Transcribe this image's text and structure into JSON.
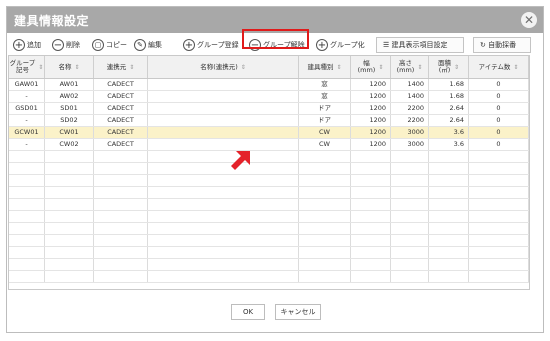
{
  "dialog": {
    "title": "建具情報設定"
  },
  "toolbar": {
    "add": "追加",
    "delete": "削除",
    "copy": "コピー",
    "edit": "編集",
    "group_register": "グループ登録",
    "group_release": "グループ解除",
    "group_more": "グループ化",
    "display_settings": "建具表示項目設定",
    "auto_collect": "自動採番"
  },
  "table": {
    "columns": [
      "グループ記号",
      "名称",
      "連携元",
      "名称(連携元)",
      "建具種別",
      "幅(mm)",
      "高さ(mm)",
      "面積(㎡)",
      "アイテム数"
    ],
    "column_lines": [
      [
        "グループ",
        "記号"
      ],
      [
        "名称"
      ],
      [
        "連携元"
      ],
      [
        "名称(連携元)"
      ],
      [
        "建具種別"
      ],
      [
        "幅",
        "(mm)"
      ],
      [
        "高さ",
        "(mm)"
      ],
      [
        "面積",
        "(㎡)"
      ],
      [
        "アイテム数"
      ]
    ],
    "rows": [
      {
        "group": "GAW01",
        "name": "AW01",
        "source": "CADECT",
        "source_name": "",
        "type": "窓",
        "width": "1200",
        "height": "1400",
        "area": "1.68",
        "items": "0"
      },
      {
        "group": "-",
        "name": "AW02",
        "source": "CADECT",
        "source_name": "",
        "type": "窓",
        "width": "1200",
        "height": "1400",
        "area": "1.68",
        "items": "0"
      },
      {
        "group": "GSD01",
        "name": "SD01",
        "source": "CADECT",
        "source_name": "",
        "type": "ドア",
        "width": "1200",
        "height": "2200",
        "area": "2.64",
        "items": "0"
      },
      {
        "group": "-",
        "name": "SD02",
        "source": "CADECT",
        "source_name": "",
        "type": "ドア",
        "width": "1200",
        "height": "2200",
        "area": "2.64",
        "items": "0"
      },
      {
        "group": "GCW01",
        "name": "CW01",
        "source": "CADECT",
        "source_name": "",
        "type": "CW",
        "width": "1200",
        "height": "3000",
        "area": "3.6",
        "items": "0"
      },
      {
        "group": "-",
        "name": "CW02",
        "source": "CADECT",
        "source_name": "",
        "type": "CW",
        "width": "1200",
        "height": "3000",
        "area": "3.6",
        "items": "0"
      }
    ],
    "selected_row": 4
  },
  "footer": {
    "ok": "OK",
    "cancel": "キャンセル"
  },
  "colors": {
    "titlebar": "#a8a8a8",
    "highlight": "#e01b1b",
    "selected_row": "#fbf2c9",
    "arrow": "#e4222a"
  }
}
